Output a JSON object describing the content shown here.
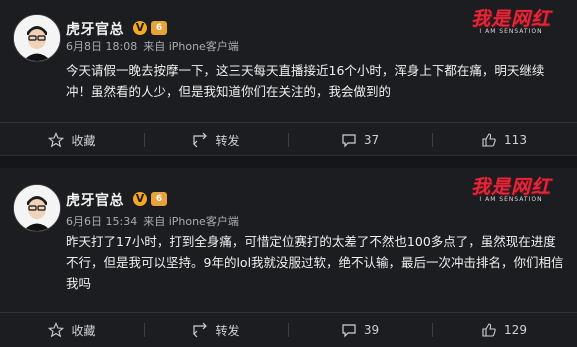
{
  "posts": [
    {
      "username": "虎牙官总",
      "v_badge": "V",
      "level_badge": "6",
      "date": "6月8日 18:08",
      "source": "来自 iPhone客户端",
      "content": "今天请假一晚去按摩一下，这三天每天直播接近16个小时，浑身上下都在痛，明天继续冲！虽然看的人少，但是我知道你们在关注的，我会做到的",
      "logo_text": "我是网红",
      "logo_sub": "I AM SENSATION",
      "actions": {
        "favorite": "收藏",
        "repost": "转发",
        "comments": "37",
        "likes": "113"
      }
    },
    {
      "username": "虎牙官总",
      "v_badge": "V",
      "level_badge": "6",
      "date": "6月6日 15:34",
      "source": "来自 iPhone客户端",
      "content": "昨天打了17小时，打到全身痛，可惜定位赛打的太差了不然也100多点了，虽然现在进度不行，但是我可以坚持。9年的lol我就没服过软，绝不认输，最后一次冲击排名，你们相信我吗",
      "logo_text": "我是网红",
      "logo_sub": "I AM SENSATION",
      "actions": {
        "favorite": "收藏",
        "repost": "转发",
        "comments": "39",
        "likes": "129"
      }
    }
  ],
  "colors": {
    "background": "#1b1d21",
    "accent_red": "#e0283a",
    "badge_gold": "#f5a623"
  }
}
